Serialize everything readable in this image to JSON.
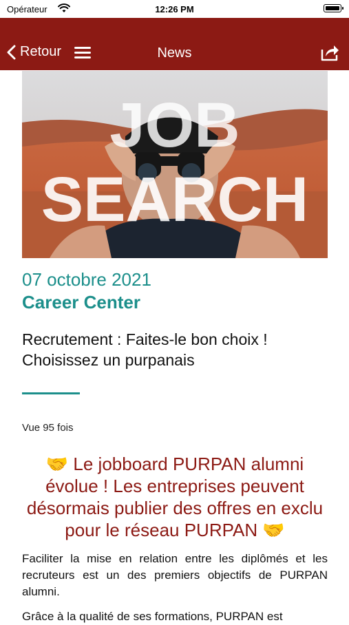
{
  "status_bar": {
    "carrier": "Opérateur",
    "time": "12:26 PM"
  },
  "nav": {
    "back_label": "Retour",
    "title": "News"
  },
  "hero": {
    "text_line1": "JOB",
    "text_line2": "SEARCH"
  },
  "article": {
    "date": "07 octobre 2021",
    "category": "Career Center",
    "title": "Recrutement : Faites-le bon choix ! Choisissez un purpanais",
    "views": "Vue 95 fois",
    "headline": "🤝 Le jobboard PURPAN alumni évolue ! Les entreprises peuvent désormais publier des offres en exclu pour le réseau PURPAN 🤝",
    "paragraphs": [
      "Faciliter la mise en relation entre les diplômés et les recruteurs est un des premiers objectifs de PURPAN alumni.",
      "Grâce à la qualité de ses formations, PURPAN est"
    ]
  },
  "colors": {
    "brand": "#8c1a14",
    "accent": "#1c8f8b"
  }
}
